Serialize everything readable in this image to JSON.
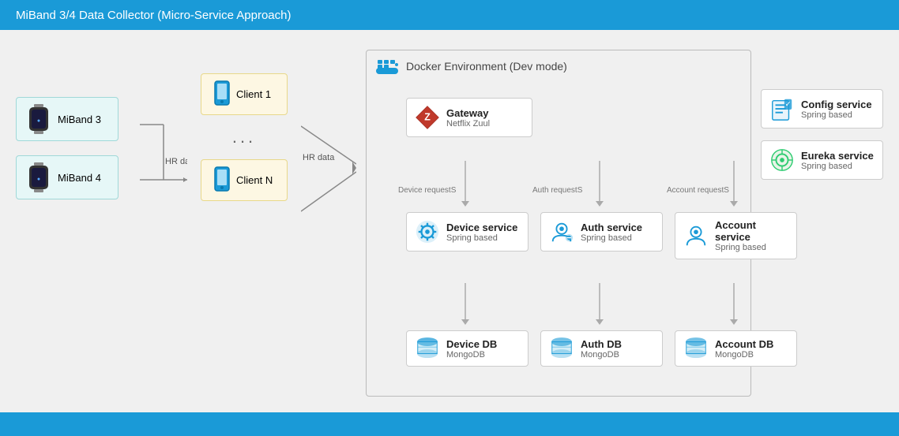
{
  "title": "MiBand 3/4 Data Collector (Micro-Service Approach)",
  "left": {
    "devices": [
      {
        "label": "MiBand 3"
      },
      {
        "label": "MiBand 4"
      }
    ],
    "hrLabel": "HR data"
  },
  "middle": {
    "client1": "Client 1",
    "clientN": "Client N",
    "hrLabel": "HR data",
    "dots": "..."
  },
  "docker": {
    "label": "Docker Environment (Dev mode)",
    "gateway": {
      "name": "Gateway",
      "sub": "Netflix Zuul"
    },
    "services": [
      {
        "name": "Device service",
        "sub": "Spring based",
        "requestLabel": "Device requestS"
      },
      {
        "name": "Auth service",
        "sub": "Spring based",
        "requestLabel": "Auth requestS"
      },
      {
        "name": "Account service",
        "sub": "Spring based",
        "requestLabel": "Account requestS"
      }
    ],
    "databases": [
      {
        "name": "Device DB",
        "sub": "MongoDB"
      },
      {
        "name": "Auth DB",
        "sub": "MongoDB"
      },
      {
        "name": "Account DB",
        "sub": "MongoDB"
      }
    ]
  },
  "rightServices": [
    {
      "name": "Config service",
      "sub": "Spring based"
    },
    {
      "name": "Eureka service",
      "sub": "Spring based"
    }
  ]
}
